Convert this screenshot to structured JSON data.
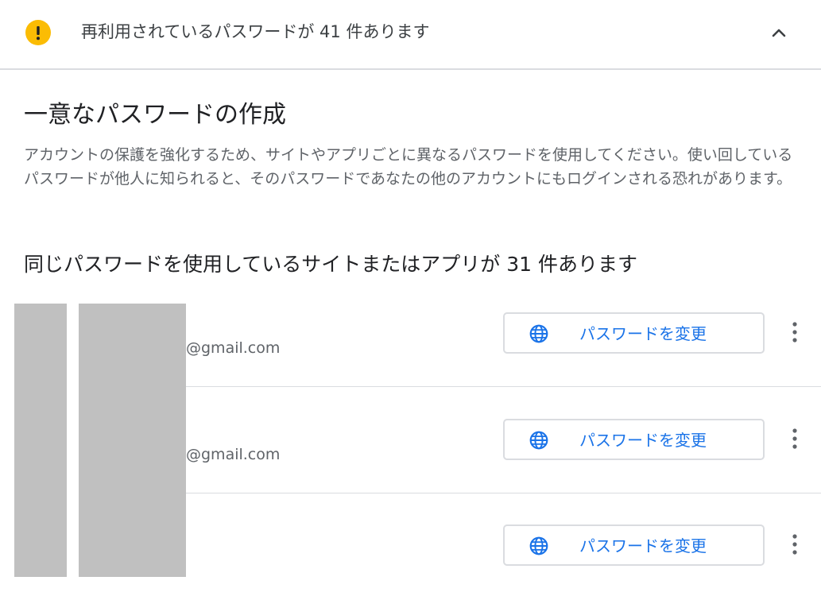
{
  "alert": {
    "icon": "warning-exclamation-icon",
    "text": "再利用されているパスワードが 41 件あります",
    "color": "#fbbc04"
  },
  "section": {
    "title": "一意なパスワードの作成",
    "description": "アカウントの保護を強化するため、サイトやアプリごとに異なるパスワードを使用してください。使い回しているパスワードが他人に知られると、そのパスワードであなたの他のアカウントにもログインされる恐れがあります。",
    "count_heading": "同じパスワードを使用しているサイトまたはアプリが 31 件あります"
  },
  "entries": [
    {
      "account": "@gmail.com",
      "button_label": "パスワードを変更"
    },
    {
      "account": "@gmail.com",
      "button_label": "パスワードを変更"
    },
    {
      "account": "",
      "button_label": "パスワードを変更"
    }
  ],
  "colors": {
    "accent": "#1a73e8",
    "warning": "#fbbc04",
    "divider": "#dadce0",
    "redaction": "#c0c0c0"
  }
}
